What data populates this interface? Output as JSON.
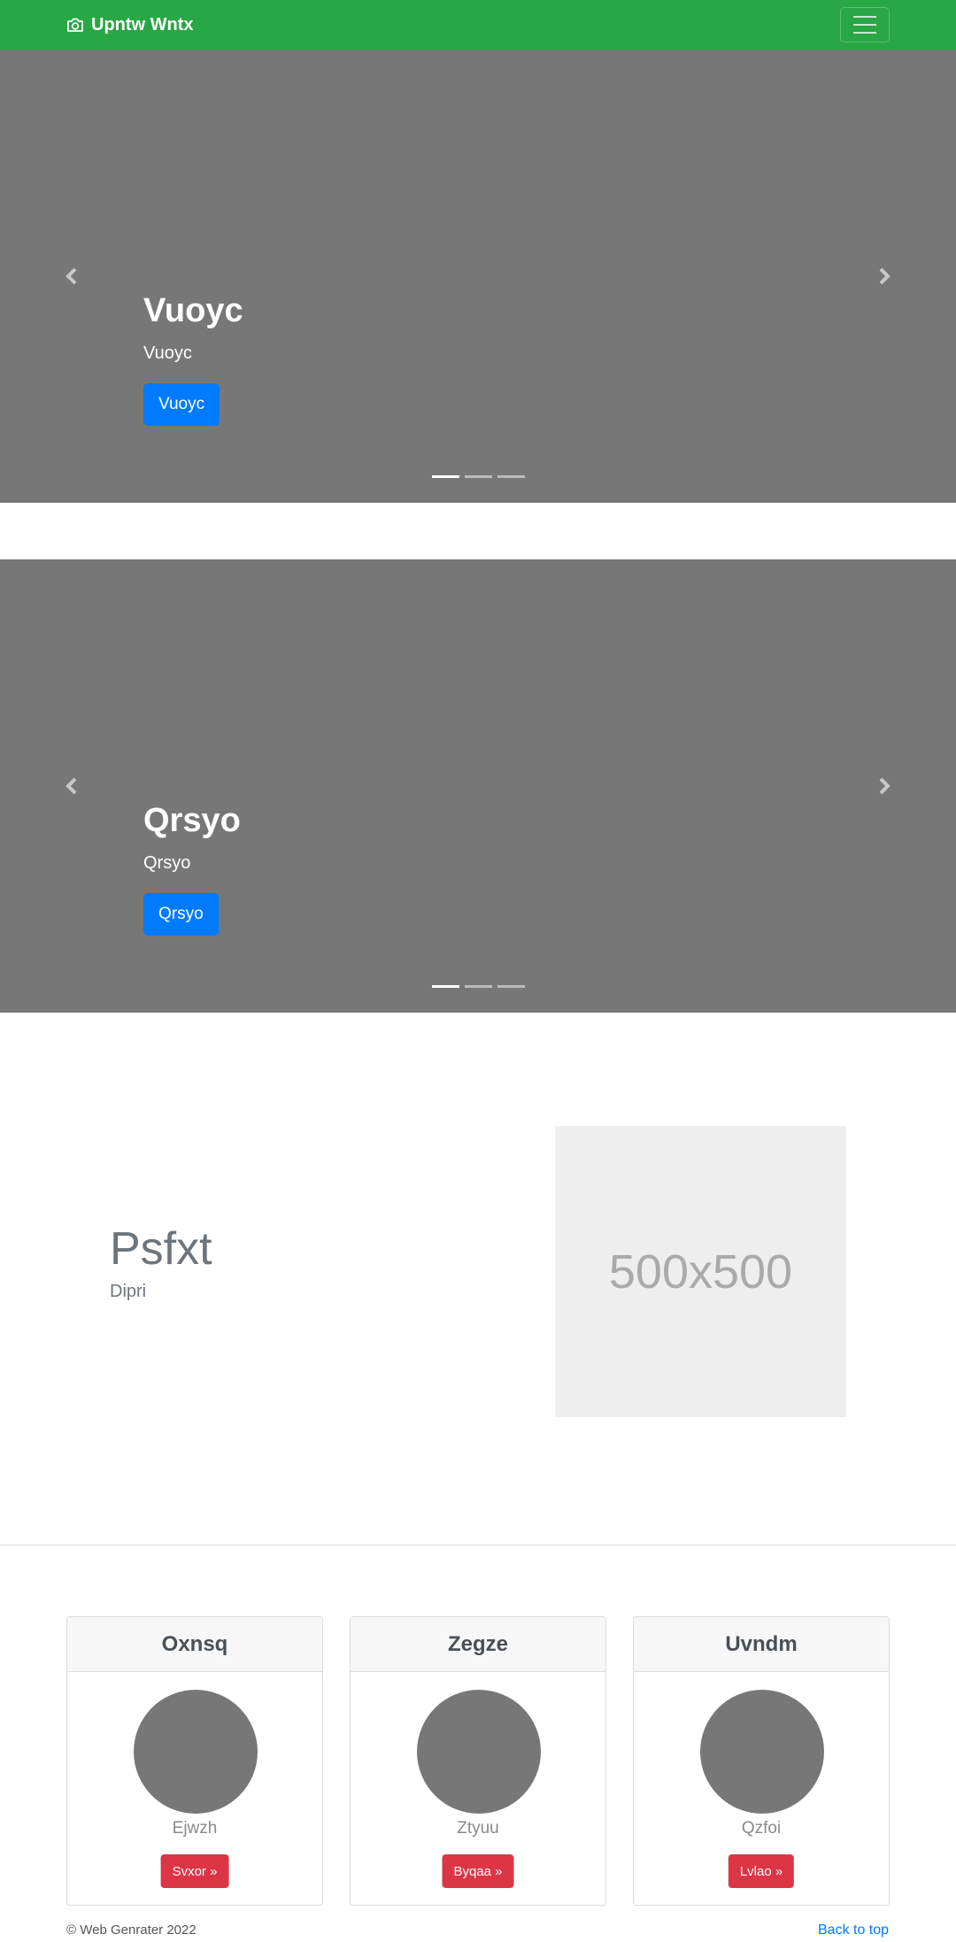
{
  "navbar": {
    "brand": "Upntw Wntx",
    "brand_icon": "camera-icon",
    "toggler_icon": "hamburger-menu-icon",
    "color": "#28a745"
  },
  "carousels": [
    {
      "title": "Vuoyc",
      "subtitle": "Vuoyc",
      "button": "Vuoyc",
      "slide_count": 3,
      "active_slide": 1
    },
    {
      "title": "Qrsyo",
      "subtitle": "Qrsyo",
      "button": "Qrsyo",
      "slide_count": 3,
      "active_slide": 1
    }
  ],
  "feature": {
    "heading": "Psfxt",
    "lead": "Dipri",
    "image_placeholder": "500x500"
  },
  "cards": [
    {
      "header": "Oxnsq",
      "name": "Ejwzh",
      "button": "Svxor »"
    },
    {
      "header": "Zegze",
      "name": "Ztyuu",
      "button": "Byqaa »"
    },
    {
      "header": "Uvndm",
      "name": "Qzfoi",
      "button": "Lvlao »"
    }
  ],
  "footer": {
    "copyright": "© Web Genrater 2022",
    "back_to_top": "Back to top"
  },
  "colors": {
    "accent_button": "#007bff",
    "danger_button": "#dc3545",
    "carousel_bg": "#777777"
  }
}
